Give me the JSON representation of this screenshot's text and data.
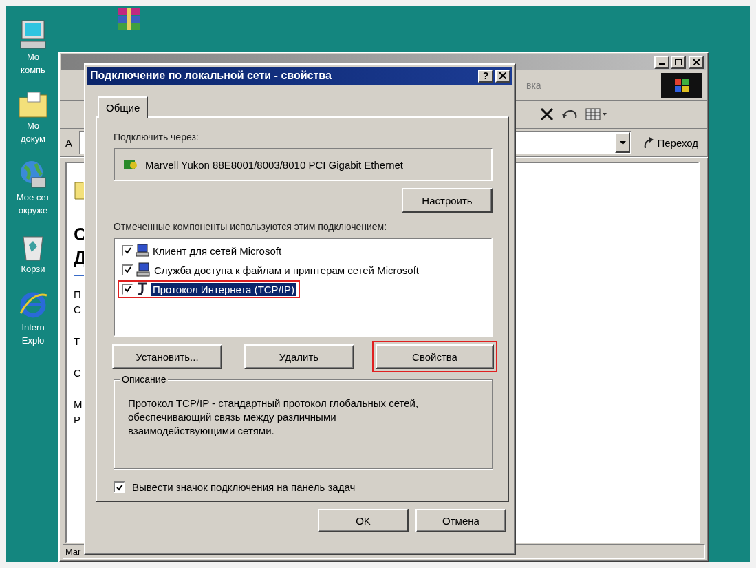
{
  "desktop": {
    "icons": [
      {
        "kind": "computer",
        "label": [
          "Мо",
          "компь"
        ]
      },
      {
        "kind": "documents",
        "label": [
          "Мо",
          "докум"
        ]
      },
      {
        "kind": "network",
        "label": [
          "Мое сет",
          "окруже"
        ]
      },
      {
        "kind": "trash",
        "label": [
          "Корзи"
        ]
      },
      {
        "kind": "browser",
        "label": [
          "Intern",
          "Explo"
        ]
      }
    ]
  },
  "explorer": {
    "menu_fragment": "вка",
    "address_label": "А",
    "go_button": "Переход",
    "status": "Mar",
    "panel_texts": [
      {
        "kind": "heading",
        "text": "С"
      },
      {
        "kind": "heading",
        "text": "Д"
      },
      {
        "kind": "rule"
      },
      {
        "kind": "line",
        "text": "П"
      },
      {
        "kind": "line",
        "text": "С"
      },
      {
        "kind": "gap"
      },
      {
        "kind": "line",
        "text": "Т"
      },
      {
        "kind": "gap"
      },
      {
        "kind": "line",
        "text": "С"
      },
      {
        "kind": "gap"
      },
      {
        "kind": "line",
        "text": "М"
      },
      {
        "kind": "line",
        "text": "Р"
      }
    ]
  },
  "dialog": {
    "title": "Подключение по локальной сети - свойства",
    "help_button": "?",
    "tabs": [
      {
        "label": "Общие",
        "selected": true
      }
    ],
    "connect_via_label": "Подключить через:",
    "adapter": "Marvell Yukon 88E8001/8003/8010 PCI Gigabit Ethernet",
    "configure_button": "Настроить",
    "components_label": "Отмеченные компоненты используются этим подключением:",
    "components": [
      {
        "kind": "client",
        "label": "Клиент для сетей Microsoft",
        "checked": true,
        "selected": false,
        "highlighted": false
      },
      {
        "kind": "service",
        "label": "Служба доступа к файлам и принтерам сетей Microsoft",
        "checked": true,
        "selected": false,
        "highlighted": false
      },
      {
        "kind": "protocol",
        "label": "Протокол Интернета (TCP/IP)",
        "checked": true,
        "selected": true,
        "highlighted": true
      }
    ],
    "component_buttons": [
      {
        "label": "Установить...",
        "highlighted": false
      },
      {
        "label": "Удалить",
        "highlighted": false
      },
      {
        "label": "Свойства",
        "highlighted": true
      }
    ],
    "description_title": "Описание",
    "description": "Протокол TCP/IP - стандартный протокол глобальных сетей, обеспечивающий связь между различными взаимодействующими сетями.",
    "show_icon": {
      "label": "Вывести значок подключения на панель задач",
      "checked": true
    },
    "buttons": [
      "OK",
      "Отмена"
    ]
  }
}
